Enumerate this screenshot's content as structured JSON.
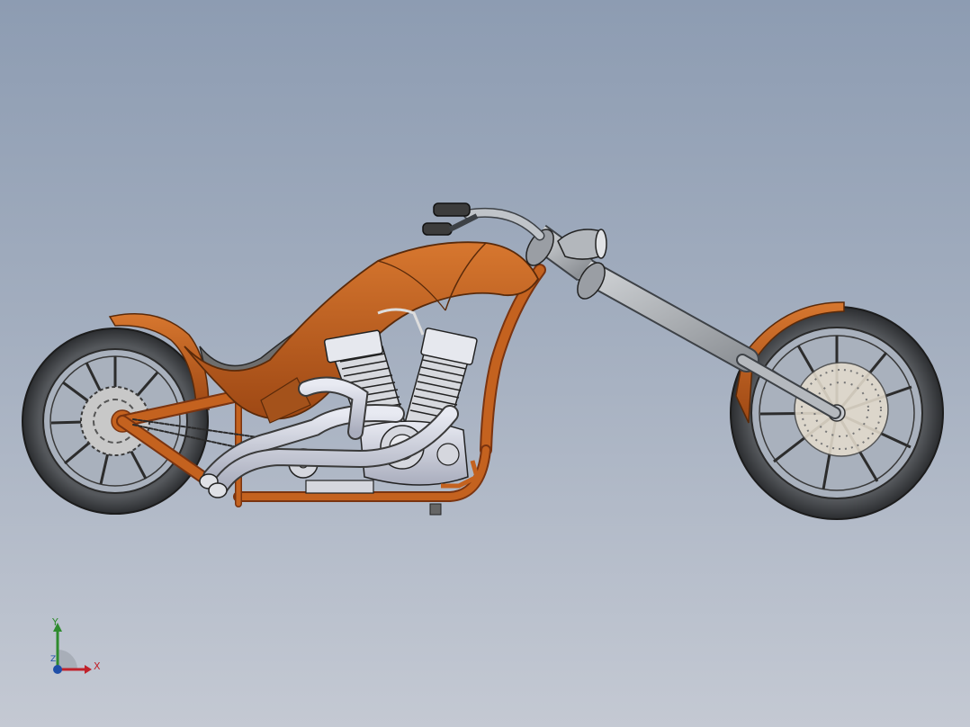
{
  "viewport": {
    "background_top": "#8d9cb2",
    "background_bottom": "#c4c9d3"
  },
  "model": {
    "body_color": "#c4621f",
    "body_shadow": "#8f3e10",
    "chrome_color": "#c9ccd8",
    "fork_color": "#a7abb0",
    "tire_color": "#3a3c3f",
    "rim_color": "#b9bcc1",
    "outline_color": "#222222"
  },
  "triad": {
    "x_label": "X",
    "y_label": "Y",
    "z_label": "Z",
    "x_color": "#c0212a",
    "y_color": "#2e8b2e",
    "z_color": "#1f4fa8"
  }
}
